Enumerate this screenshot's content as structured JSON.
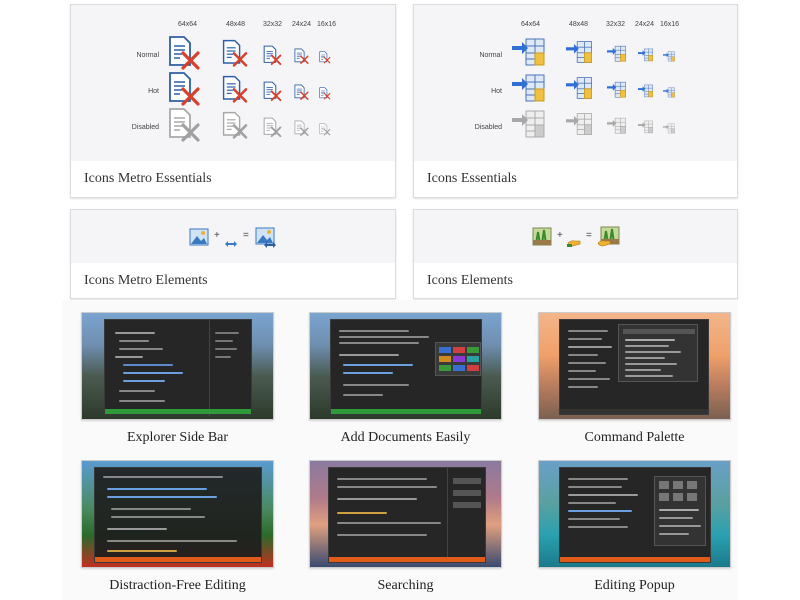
{
  "icon_cards": [
    {
      "caption": "Icons Metro Essentials",
      "sizes": [
        "64x64",
        "48x48",
        "32x32",
        "24x24",
        "16x16"
      ],
      "rows": [
        "Normal",
        "Hot",
        "Disabled"
      ]
    },
    {
      "caption": "Icons Essentials",
      "sizes": [
        "64x64",
        "48x48",
        "32x32",
        "24x24",
        "16x16"
      ],
      "rows": [
        "Normal",
        "Hot",
        "Disabled"
      ]
    },
    {
      "caption": "Icons Metro Elements",
      "plus": "+",
      "equals": "="
    },
    {
      "caption": "Icons Elements",
      "plus": "+",
      "equals": "="
    }
  ],
  "screenshots": [
    {
      "caption": "Explorer Side Bar",
      "accent": "#2e9a3a"
    },
    {
      "caption": "Add Documents Easily",
      "accent": "#2e9a3a"
    },
    {
      "caption": "Command Palette",
      "accent": "#333333"
    },
    {
      "caption": "Distraction-Free Editing",
      "accent": "#e05a1a"
    },
    {
      "caption": "Searching",
      "accent": "#e05a1a"
    },
    {
      "caption": "Editing Popup",
      "accent": "#e05a1a"
    }
  ],
  "colors": {
    "red_x": "#d9402b",
    "doc_blue": "#2d5fa8",
    "arrow_blue": "#2f6fd6",
    "grid_yellow": "#f0c040",
    "disabled_gray": "#a8a8a8"
  }
}
